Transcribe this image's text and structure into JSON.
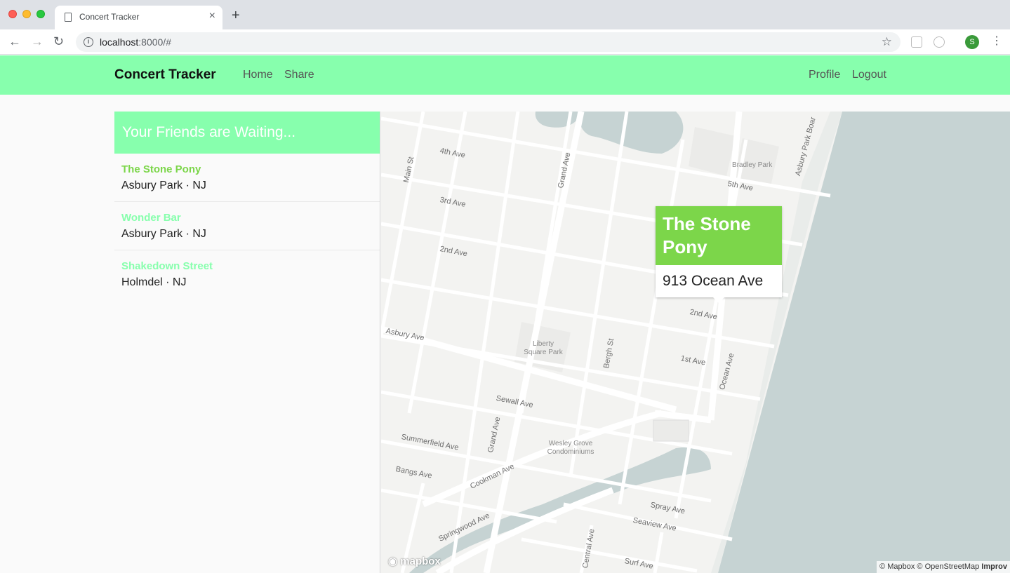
{
  "browser": {
    "tab_title": "Concert Tracker",
    "tab_close": "×",
    "new_tab": "+",
    "url_host": "localhost",
    "url_rest": ":8000/#",
    "profile_initial": "S"
  },
  "navbar": {
    "brand": "Concert Tracker",
    "links": [
      "Home",
      "Share"
    ],
    "right_links": [
      "Profile",
      "Logout"
    ],
    "bg_color": "#87ffad"
  },
  "sidebar": {
    "heading": "Your Friends are Waiting...",
    "venues": [
      {
        "name": "The Stone Pony",
        "location": "Asbury Park · NJ",
        "color": "#7cd64a"
      },
      {
        "name": "Wonder Bar",
        "location": "Asbury Park · NJ",
        "color": "#87ffad"
      },
      {
        "name": "Shakedown Street",
        "location": "Holmdel · NJ",
        "color": "#87ffad"
      }
    ]
  },
  "map": {
    "popup": {
      "title": "The Stone Pony",
      "address": "913 Ocean Ave"
    },
    "streets": [
      "4th Ave",
      "3rd Ave",
      "2nd Ave",
      "Asbury Ave",
      "Sewall Ave",
      "Summerfield Ave",
      "Bangs Ave",
      "Cookman Ave",
      "Springwood Ave",
      "Spray Ave",
      "Seaview Ave",
      "Surf Ave",
      "5th Ave",
      "2nd Ave",
      "1st Ave",
      "Main St",
      "Grand Ave",
      "Bergh St",
      "Ocean Ave",
      "Grand Ave",
      "Central Ave",
      "Asbury Park Boar"
    ],
    "parks": [
      "Bradley Park",
      "Liberty\nSquare Park",
      "Wesley Grove\nCondominiums"
    ],
    "logo": "mapbox",
    "attribution": "© Mapbox © OpenStreetMap",
    "attribution_link": "Improv"
  }
}
